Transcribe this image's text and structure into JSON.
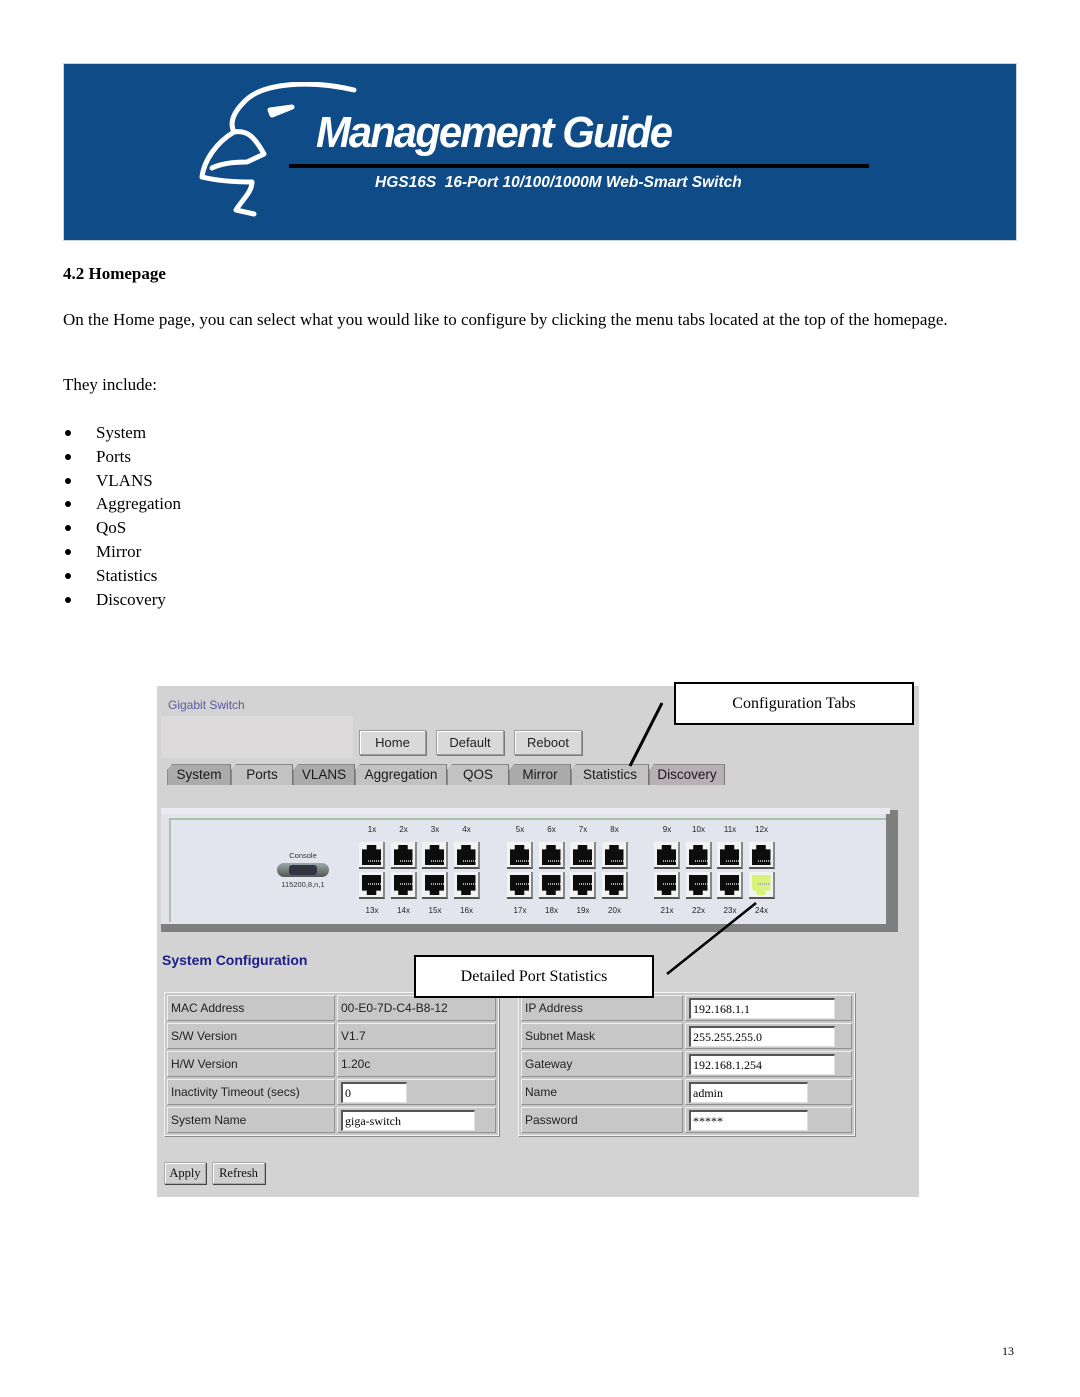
{
  "banner": {
    "title": "Management Guide",
    "subtitle": "HGS16S  16-Port 10/100/1000M Web-Smart Switch",
    "logo_icon": "eagle-head-logo-icon",
    "background_color": "#0f4b86"
  },
  "section": {
    "heading": "4.2 Homepage",
    "paragraph": "On the Home page, you can select what you would like to configure by clicking the menu tabs located at the top of the homepage.",
    "intro": "They include:",
    "items": [
      "System",
      "Ports",
      "VLANS",
      "Aggregation",
      "QoS",
      "Mirror",
      "Statistics",
      "Discovery"
    ]
  },
  "screenshot": {
    "app_title": "Gigabit Switch",
    "top_buttons": [
      "Home",
      "Default",
      "Reboot"
    ],
    "tabs": [
      "System",
      "Ports",
      "VLANS",
      "Aggregation",
      "QOS",
      "Mirror",
      "Statistics",
      "Discovery"
    ],
    "switch_panel": {
      "console_label": "Console",
      "console_settings": "115200,8,n,1",
      "top_port_labels": [
        "1x",
        "2x",
        "3x",
        "4x",
        "5x",
        "6x",
        "7x",
        "8x",
        "9x",
        "10x",
        "11x",
        "12x"
      ],
      "bottom_port_labels": [
        "13x",
        "14x",
        "15x",
        "16x",
        "17x",
        "18x",
        "19x",
        "20x",
        "21x",
        "22x",
        "23x",
        "24x"
      ],
      "active_ports": [
        "24x"
      ],
      "active_port_color": "#d9f27a"
    },
    "system_config": {
      "heading": "System Configuration",
      "left_rows": [
        {
          "label": "MAC Address",
          "value": "00-E0-7D-C4-B8-12",
          "type": "text"
        },
        {
          "label": "S/W Version",
          "value": "V1.7",
          "type": "text"
        },
        {
          "label": "H/W Version",
          "value": "1.20c",
          "type": "text"
        },
        {
          "label": "Inactivity Timeout (secs)",
          "value": "0",
          "type": "input"
        },
        {
          "label": "System Name",
          "value": "giga-switch",
          "type": "input"
        }
      ],
      "right_rows": [
        {
          "label": "IP Address",
          "value": "192.168.1.1"
        },
        {
          "label": "Subnet Mask",
          "value": "255.255.255.0"
        },
        {
          "label": "Gateway",
          "value": "192.168.1.254"
        },
        {
          "label": "Name",
          "value": "admin"
        },
        {
          "label": "Password",
          "value": "*****"
        }
      ]
    },
    "action_buttons": {
      "apply": "Apply",
      "refresh": "Refresh"
    }
  },
  "callouts": {
    "configuration_tabs": "Configuration Tabs",
    "detailed_port_statistics": "Detailed Port Statistics"
  },
  "page_number": "13"
}
